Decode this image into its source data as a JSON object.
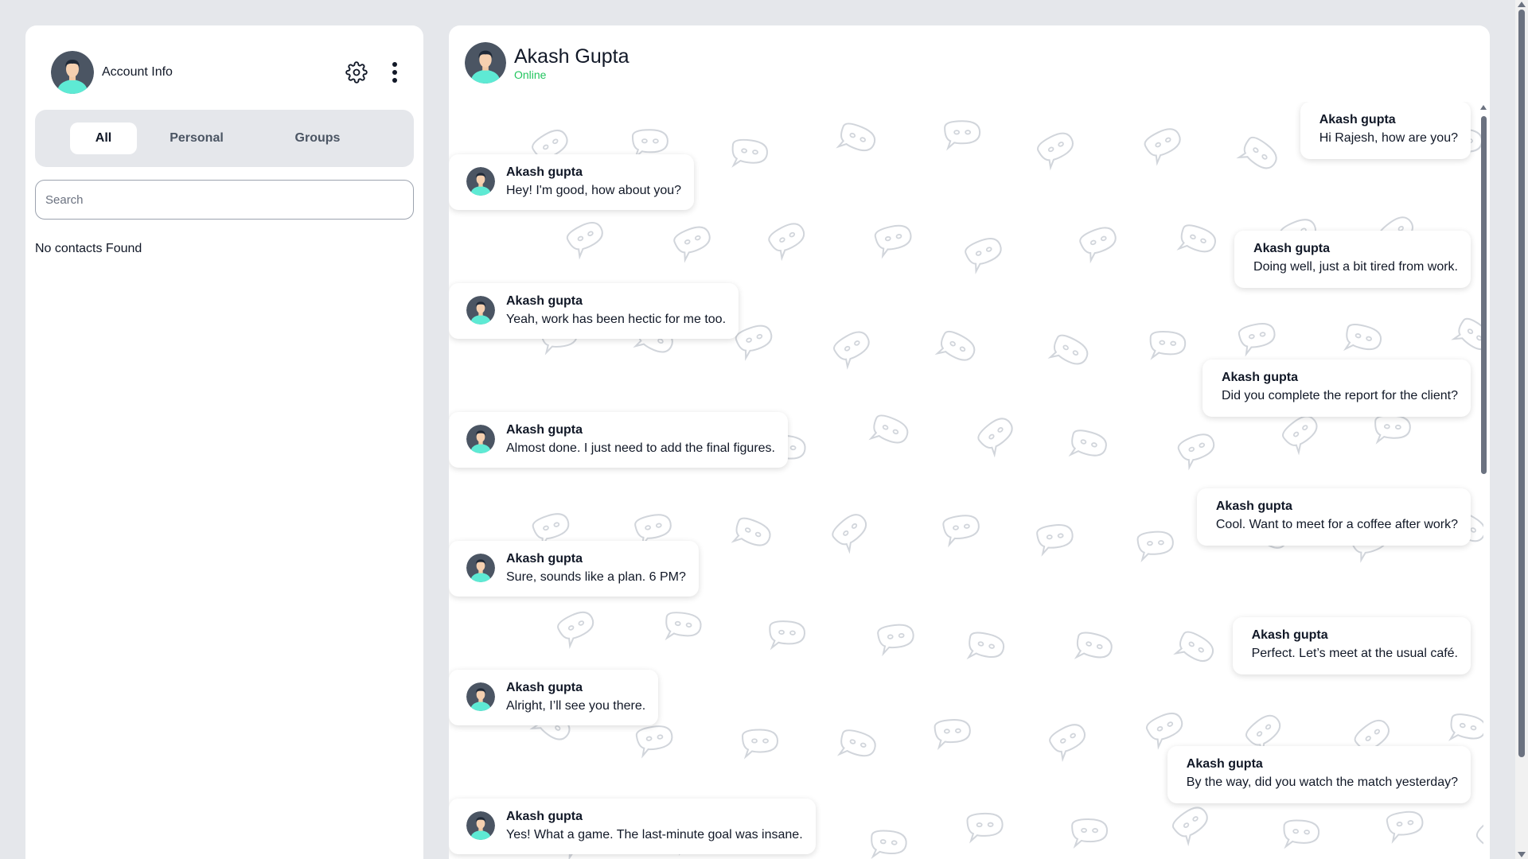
{
  "sidebar": {
    "account_label": "Account Info",
    "avatar_icon": "user-avatar",
    "settings_icon": "gear-icon",
    "menu_icon": "kebab-menu-icon",
    "tabs": [
      {
        "label": "All",
        "active": true
      },
      {
        "label": "Personal",
        "active": false
      },
      {
        "label": "Groups",
        "active": false
      }
    ],
    "search": {
      "placeholder": "Search",
      "value": ""
    },
    "empty_text": "No contacts Found"
  },
  "chat": {
    "contact_name": "Akash Gupta",
    "contact_status": "Online",
    "status_color": "#22c55e",
    "messages": [
      {
        "direction": "out",
        "sender": "Akash gupta",
        "text": "Hi Rajesh, how are you?"
      },
      {
        "direction": "in",
        "sender": "Akash gupta",
        "text": "Hey! I'm good, how about you?"
      },
      {
        "direction": "out",
        "sender": "Akash gupta",
        "text": "Doing well, just a bit tired from work."
      },
      {
        "direction": "in",
        "sender": "Akash gupta",
        "text": "Yeah, work has been hectic for me too."
      },
      {
        "direction": "out",
        "sender": "Akash gupta",
        "text": "Did you complete the report for the client?"
      },
      {
        "direction": "in",
        "sender": "Akash gupta",
        "text": "Almost done. I just need to add the final figures."
      },
      {
        "direction": "out",
        "sender": "Akash gupta",
        "text": "Cool. Want to meet for a coffee after work?"
      },
      {
        "direction": "in",
        "sender": "Akash gupta",
        "text": "Sure, sounds like a plan. 6 PM?"
      },
      {
        "direction": "out",
        "sender": "Akash gupta",
        "text": "Perfect. Let’s meet at the usual café."
      },
      {
        "direction": "in",
        "sender": "Akash gupta",
        "text": "Alright, I’ll see you there."
      },
      {
        "direction": "out",
        "sender": "Akash gupta",
        "text": "By the way, did you watch the match yesterday?"
      },
      {
        "direction": "in",
        "sender": "Akash gupta",
        "text": "Yes! What a game. The last-minute goal was insane."
      }
    ]
  }
}
